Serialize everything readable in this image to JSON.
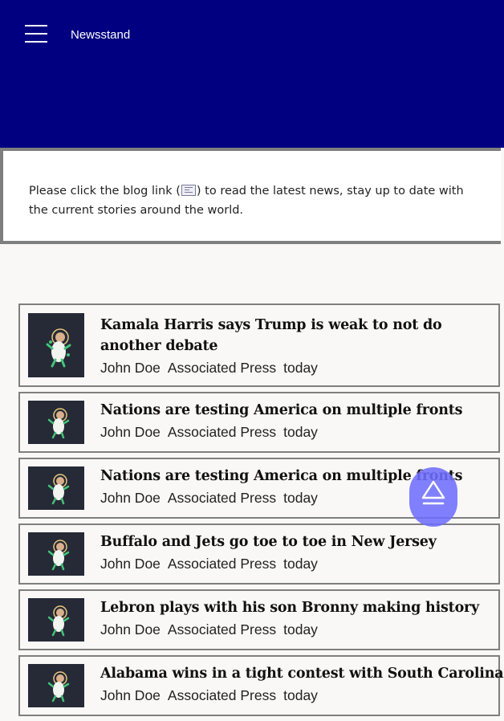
{
  "header": {
    "title": "Newsstand",
    "menu_icon": "hamburger-menu-icon",
    "background": "#000080"
  },
  "notice": {
    "text_before": "Please click the blog link (",
    "icon": "blog-newspaper-icon",
    "text_after": ") to read the latest news, stay up to date with the current stories around the world."
  },
  "articles": [
    {
      "title": "Kamala Harris says Trump is weak to not do another debate",
      "author": "John Doe",
      "source": "Associated Press",
      "date": "today",
      "thumbnail": "astronaut-thumbnail"
    },
    {
      "title": "Nations are testing America on multiple fronts",
      "author": "John Doe",
      "source": "Associated Press",
      "date": "today",
      "thumbnail": "astronaut-thumbnail"
    },
    {
      "title": "Nations are testing America on multiple fronts",
      "author": "John Doe",
      "source": "Associated Press",
      "date": "today",
      "thumbnail": "astronaut-thumbnail"
    },
    {
      "title": "Buffalo and Jets go toe to toe in New Jersey",
      "author": "John Doe",
      "source": "Associated Press",
      "date": "today",
      "thumbnail": "astronaut-thumbnail"
    },
    {
      "title": "Lebron plays with his son Bronny making history",
      "author": "John Doe",
      "source": "Associated Press",
      "date": "today",
      "thumbnail": "astronaut-thumbnail"
    },
    {
      "title": "Alabama wins in a tight contest with South Carolina",
      "author": "John Doe",
      "source": "Associated Press",
      "date": "today",
      "thumbnail": "astronaut-thumbnail"
    }
  ],
  "fab": {
    "icon": "scroll-to-top-icon",
    "color": "#6e6eff"
  }
}
